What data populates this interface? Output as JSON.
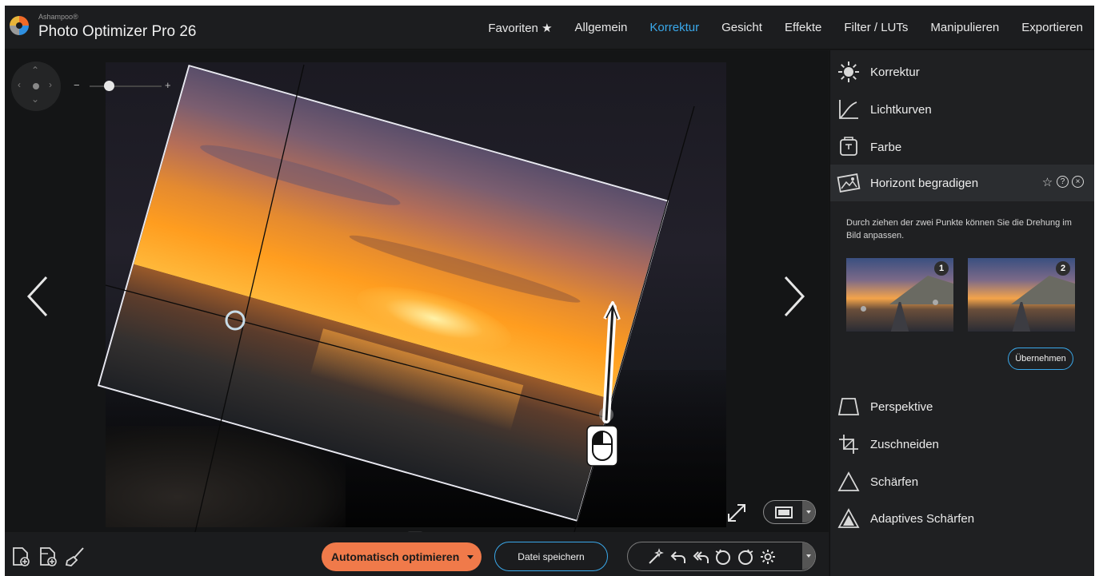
{
  "app": {
    "vendor": "Ashampoo®",
    "name": "Photo Optimizer Pro 26"
  },
  "nav": {
    "items": [
      "Favoriten ★",
      "Allgemein",
      "Korrektur",
      "Gesicht",
      "Effekte",
      "Filter / LUTs",
      "Manipulieren",
      "Exportieren"
    ],
    "active": "Korrektur"
  },
  "zoom": {
    "minus": "−",
    "plus": "+",
    "level": 0.35
  },
  "bottom": {
    "auto_optimize": "Automatisch optimieren",
    "save_file": "Datei speichern"
  },
  "panel": {
    "items": [
      {
        "label": "Korrektur",
        "icon": "sun-icon"
      },
      {
        "label": "Lichtkurven",
        "icon": "curve-icon"
      },
      {
        "label": "Farbe",
        "icon": "palette-icon"
      },
      {
        "label": "Horizont begradigen",
        "icon": "image-rotate-icon"
      },
      {
        "label": "Perspektive",
        "icon": "perspective-icon"
      },
      {
        "label": "Zuschneiden",
        "icon": "crop-icon"
      },
      {
        "label": "Schärfen",
        "icon": "triangle-icon"
      },
      {
        "label": "Adaptives Schärfen",
        "icon": "filled-triangle-icon"
      }
    ],
    "help": "Durch ziehen der zwei Punkte können Sie die Drehung im Bild anpassen.",
    "thumb1_badge": "1",
    "thumb2_badge": "2",
    "apply": "Übernehmen"
  },
  "colors": {
    "accent": "#3aa8ea",
    "auto_button": "#f07a4a",
    "background": "#171819",
    "panel": "#1f2022"
  }
}
